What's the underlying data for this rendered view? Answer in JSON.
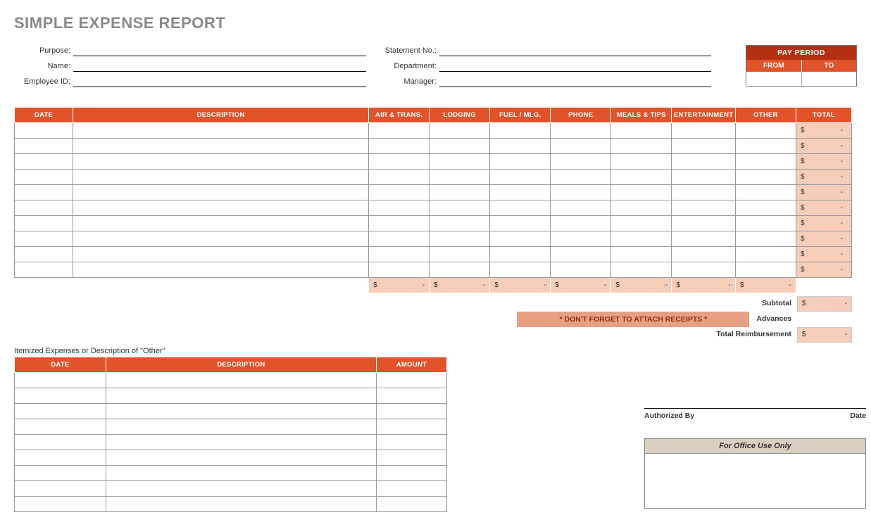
{
  "title": "SIMPLE EXPENSE REPORT",
  "info": {
    "left": [
      {
        "label": "Purpose:"
      },
      {
        "label": "Name:"
      },
      {
        "label": "Employee ID:"
      }
    ],
    "right": [
      {
        "label": "Statement No.:"
      },
      {
        "label": "Department:"
      },
      {
        "label": "Manager:"
      }
    ]
  },
  "pay_period": {
    "header": "PAY PERIOD",
    "from": "FROM",
    "to": "TO"
  },
  "main_headers": [
    "DATE",
    "DESCRIPTION",
    "AIR & TRANS.",
    "LODGING",
    "FUEL / MLG.",
    "PHONE",
    "MEALS & TIPS",
    "ENTERTAINMENT",
    "OTHER",
    "TOTAL"
  ],
  "row_total": {
    "cur": "$",
    "val": "-"
  },
  "col_total": {
    "cur": "$",
    "val": "-"
  },
  "note": "* DON'T FORGET TO ATTACH RECEIPTS *",
  "summary": {
    "subtotal_label": "Subtotal",
    "advances_label": "Advances",
    "reimburse_label": "Total Reimbursement",
    "val_cur": "$",
    "val_dash": "-"
  },
  "itemized_title": "Itemized Expenses or Description of \"Other\"",
  "itemized_headers": [
    "DATE",
    "DESCRIPTION",
    "AMOUNT"
  ],
  "sig": {
    "auth": "Authorized By",
    "date": "Date"
  },
  "office": "For Office Use Only"
}
